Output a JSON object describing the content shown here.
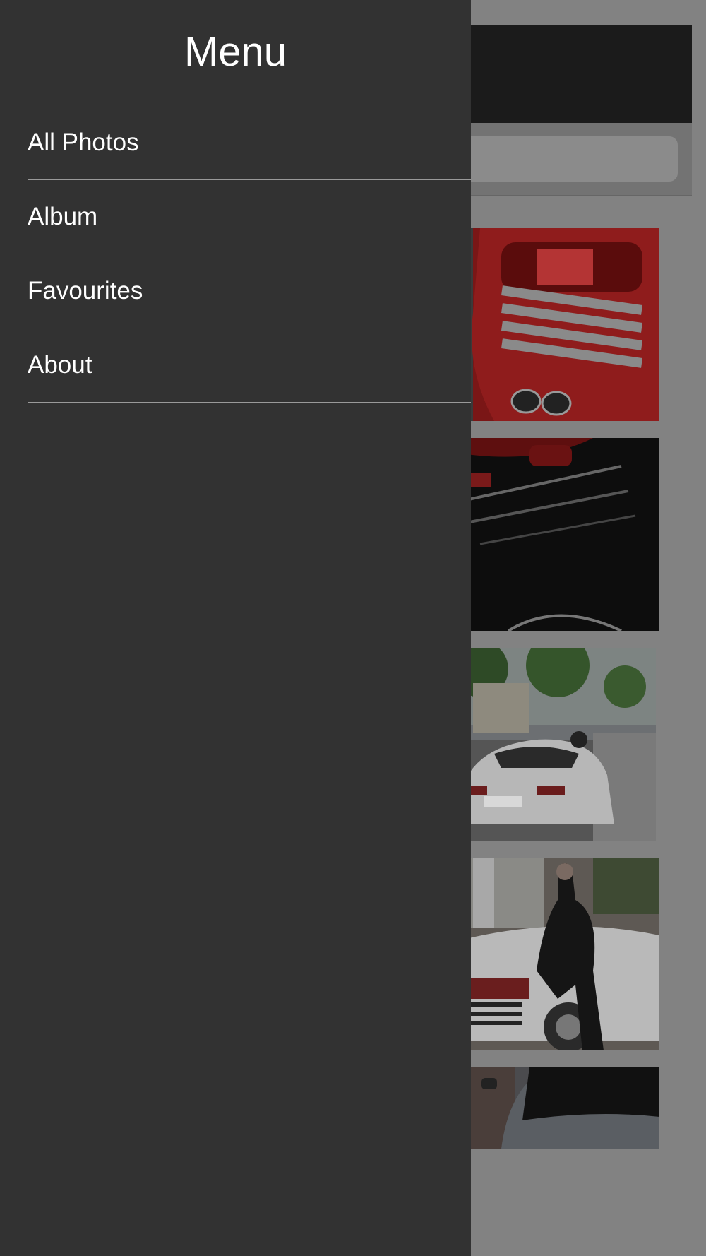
{
  "drawer": {
    "title": "Menu",
    "items": [
      {
        "label": "All Photos"
      },
      {
        "label": "Album"
      },
      {
        "label": "Favourites"
      },
      {
        "label": "About"
      }
    ]
  },
  "colors": {
    "drawer_bg": "#323232",
    "overlay_bg": "#828282",
    "divider": "#9a9a9a",
    "text": "#ffffff"
  },
  "background_photos": [
    {
      "subject": "red car rear detail"
    },
    {
      "subject": "black car rear detail"
    },
    {
      "subject": "white car on street"
    },
    {
      "subject": "woman leaning on white car"
    },
    {
      "subject": "dark car hood"
    }
  ]
}
